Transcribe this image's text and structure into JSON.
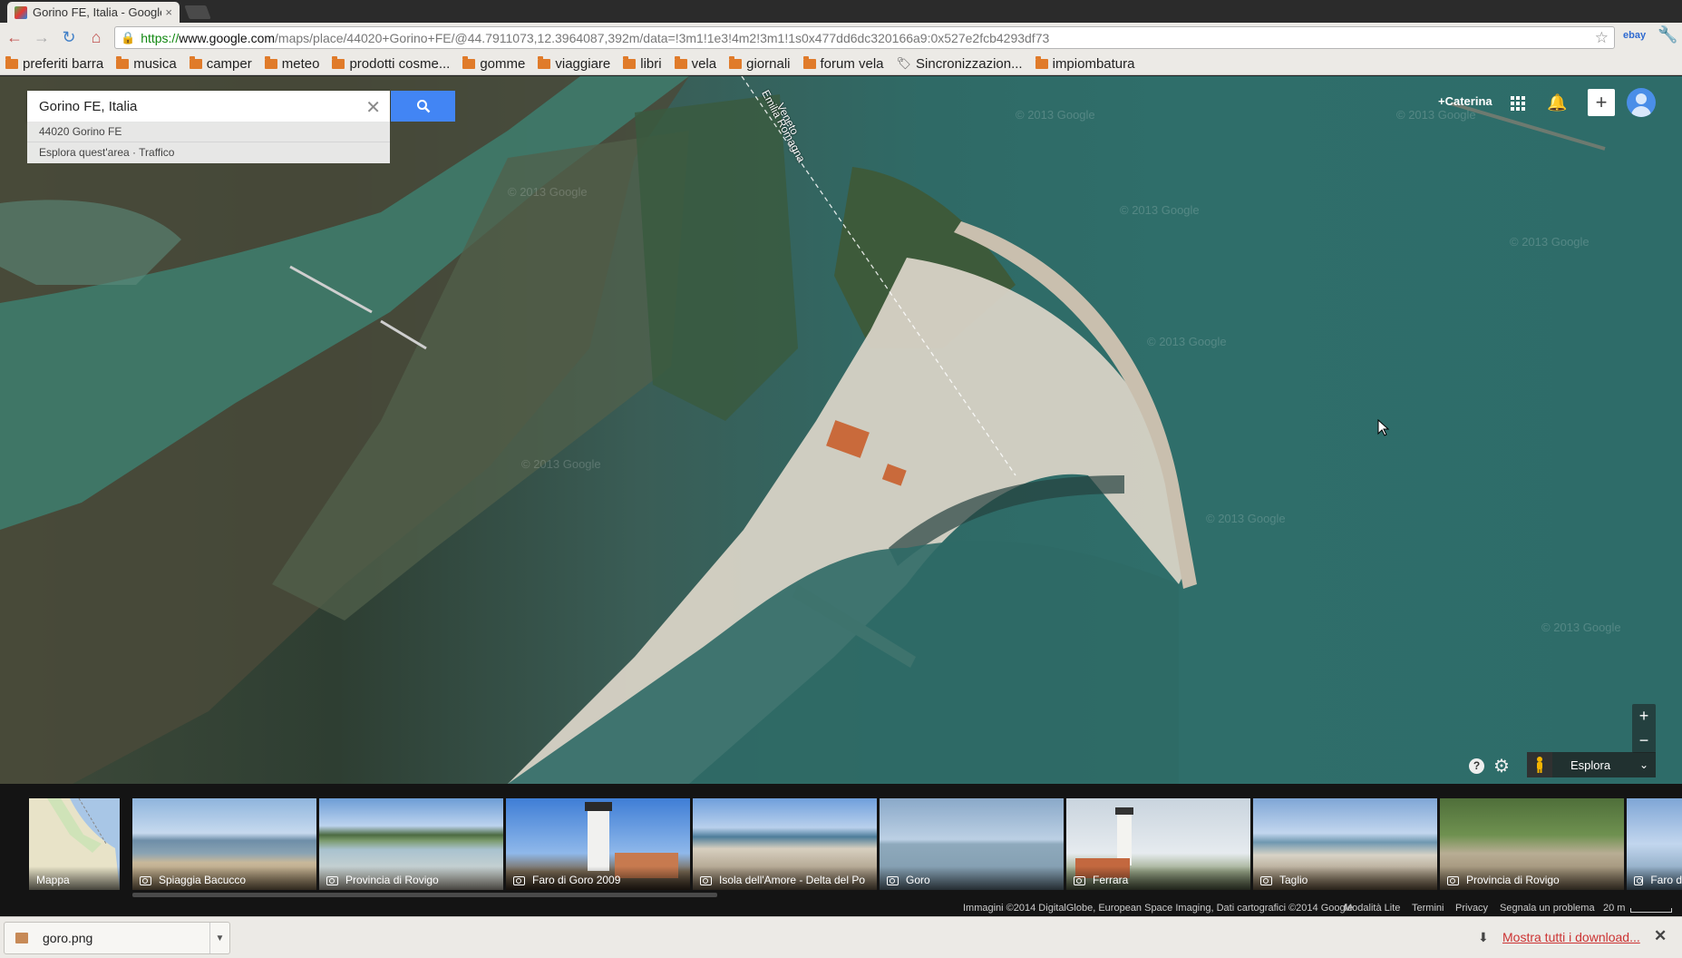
{
  "browser": {
    "tab_title": "Gorino FE, Italia - Google M",
    "tab_close": "×",
    "url_scheme": "https://",
    "url_host": "www.google.com",
    "url_path": "/maps/place/44020+Gorino+FE/@44.7911073,12.3964087,392m/data=!3m1!1e3!4m2!3m1!1s0x477dd6dc320166a9:0x527e2fcb4293df73",
    "ext_label": "ebay"
  },
  "bookmarks": [
    {
      "label": "preferiti barra",
      "icon": "folder-icon"
    },
    {
      "label": "musica",
      "icon": "folder-icon"
    },
    {
      "label": "camper",
      "icon": "folder-icon"
    },
    {
      "label": "meteo",
      "icon": "folder-icon"
    },
    {
      "label": "prodotti cosme...",
      "icon": "folder-icon"
    },
    {
      "label": "gomme",
      "icon": "folder-icon"
    },
    {
      "label": "viaggiare",
      "icon": "folder-icon"
    },
    {
      "label": "libri",
      "icon": "folder-icon"
    },
    {
      "label": "vela",
      "icon": "folder-icon"
    },
    {
      "label": "giornali",
      "icon": "folder-icon"
    },
    {
      "label": "forum vela",
      "icon": "folder-icon"
    },
    {
      "label": "Sincronizzazion...",
      "icon": "tag-icon"
    },
    {
      "label": "impiombatura",
      "icon": "folder-icon"
    }
  ],
  "map": {
    "search_value": "Gorino FE, Italia",
    "suggestions": [
      "44020 Gorino FE",
      "Esplora quest'area · Traffico"
    ],
    "account_name": "+Caterina",
    "region_labels": [
      "Veneto",
      "Emilia Romagna"
    ],
    "watermark": "© 2013 Google",
    "explore_label": "Esplora",
    "zoom_in": "+",
    "zoom_out": "−",
    "help_symbol": "?"
  },
  "photos": [
    {
      "caption": "Mappa",
      "is_map": true
    },
    {
      "caption": "Spiaggia Bacucco"
    },
    {
      "caption": "Provincia di Rovigo"
    },
    {
      "caption": "Faro di Goro 2009"
    },
    {
      "caption": "Isola dell'Amore - Delta del Po"
    },
    {
      "caption": "Goro"
    },
    {
      "caption": "Ferrara"
    },
    {
      "caption": "Taglio"
    },
    {
      "caption": "Provincia di Rovigo"
    },
    {
      "caption": "Faro d"
    }
  ],
  "footer": {
    "attribution": "Immagini ©2014 DigitalGlobe, European Space Imaging, Dati cartografici ©2014 Google",
    "lite_mode": "Modalità Lite",
    "terms": "Termini",
    "privacy": "Privacy",
    "report": "Segnala un problema",
    "scale": "20 m"
  },
  "downloads": {
    "filename": "goro.png",
    "show_all": "Mostra tutti i download...",
    "close_symbol": "✕"
  },
  "colors": {
    "search_button": "#4285f4",
    "water": "#2f6e6a",
    "sand": "#d8d3c6",
    "link_red": "#cc3333"
  }
}
